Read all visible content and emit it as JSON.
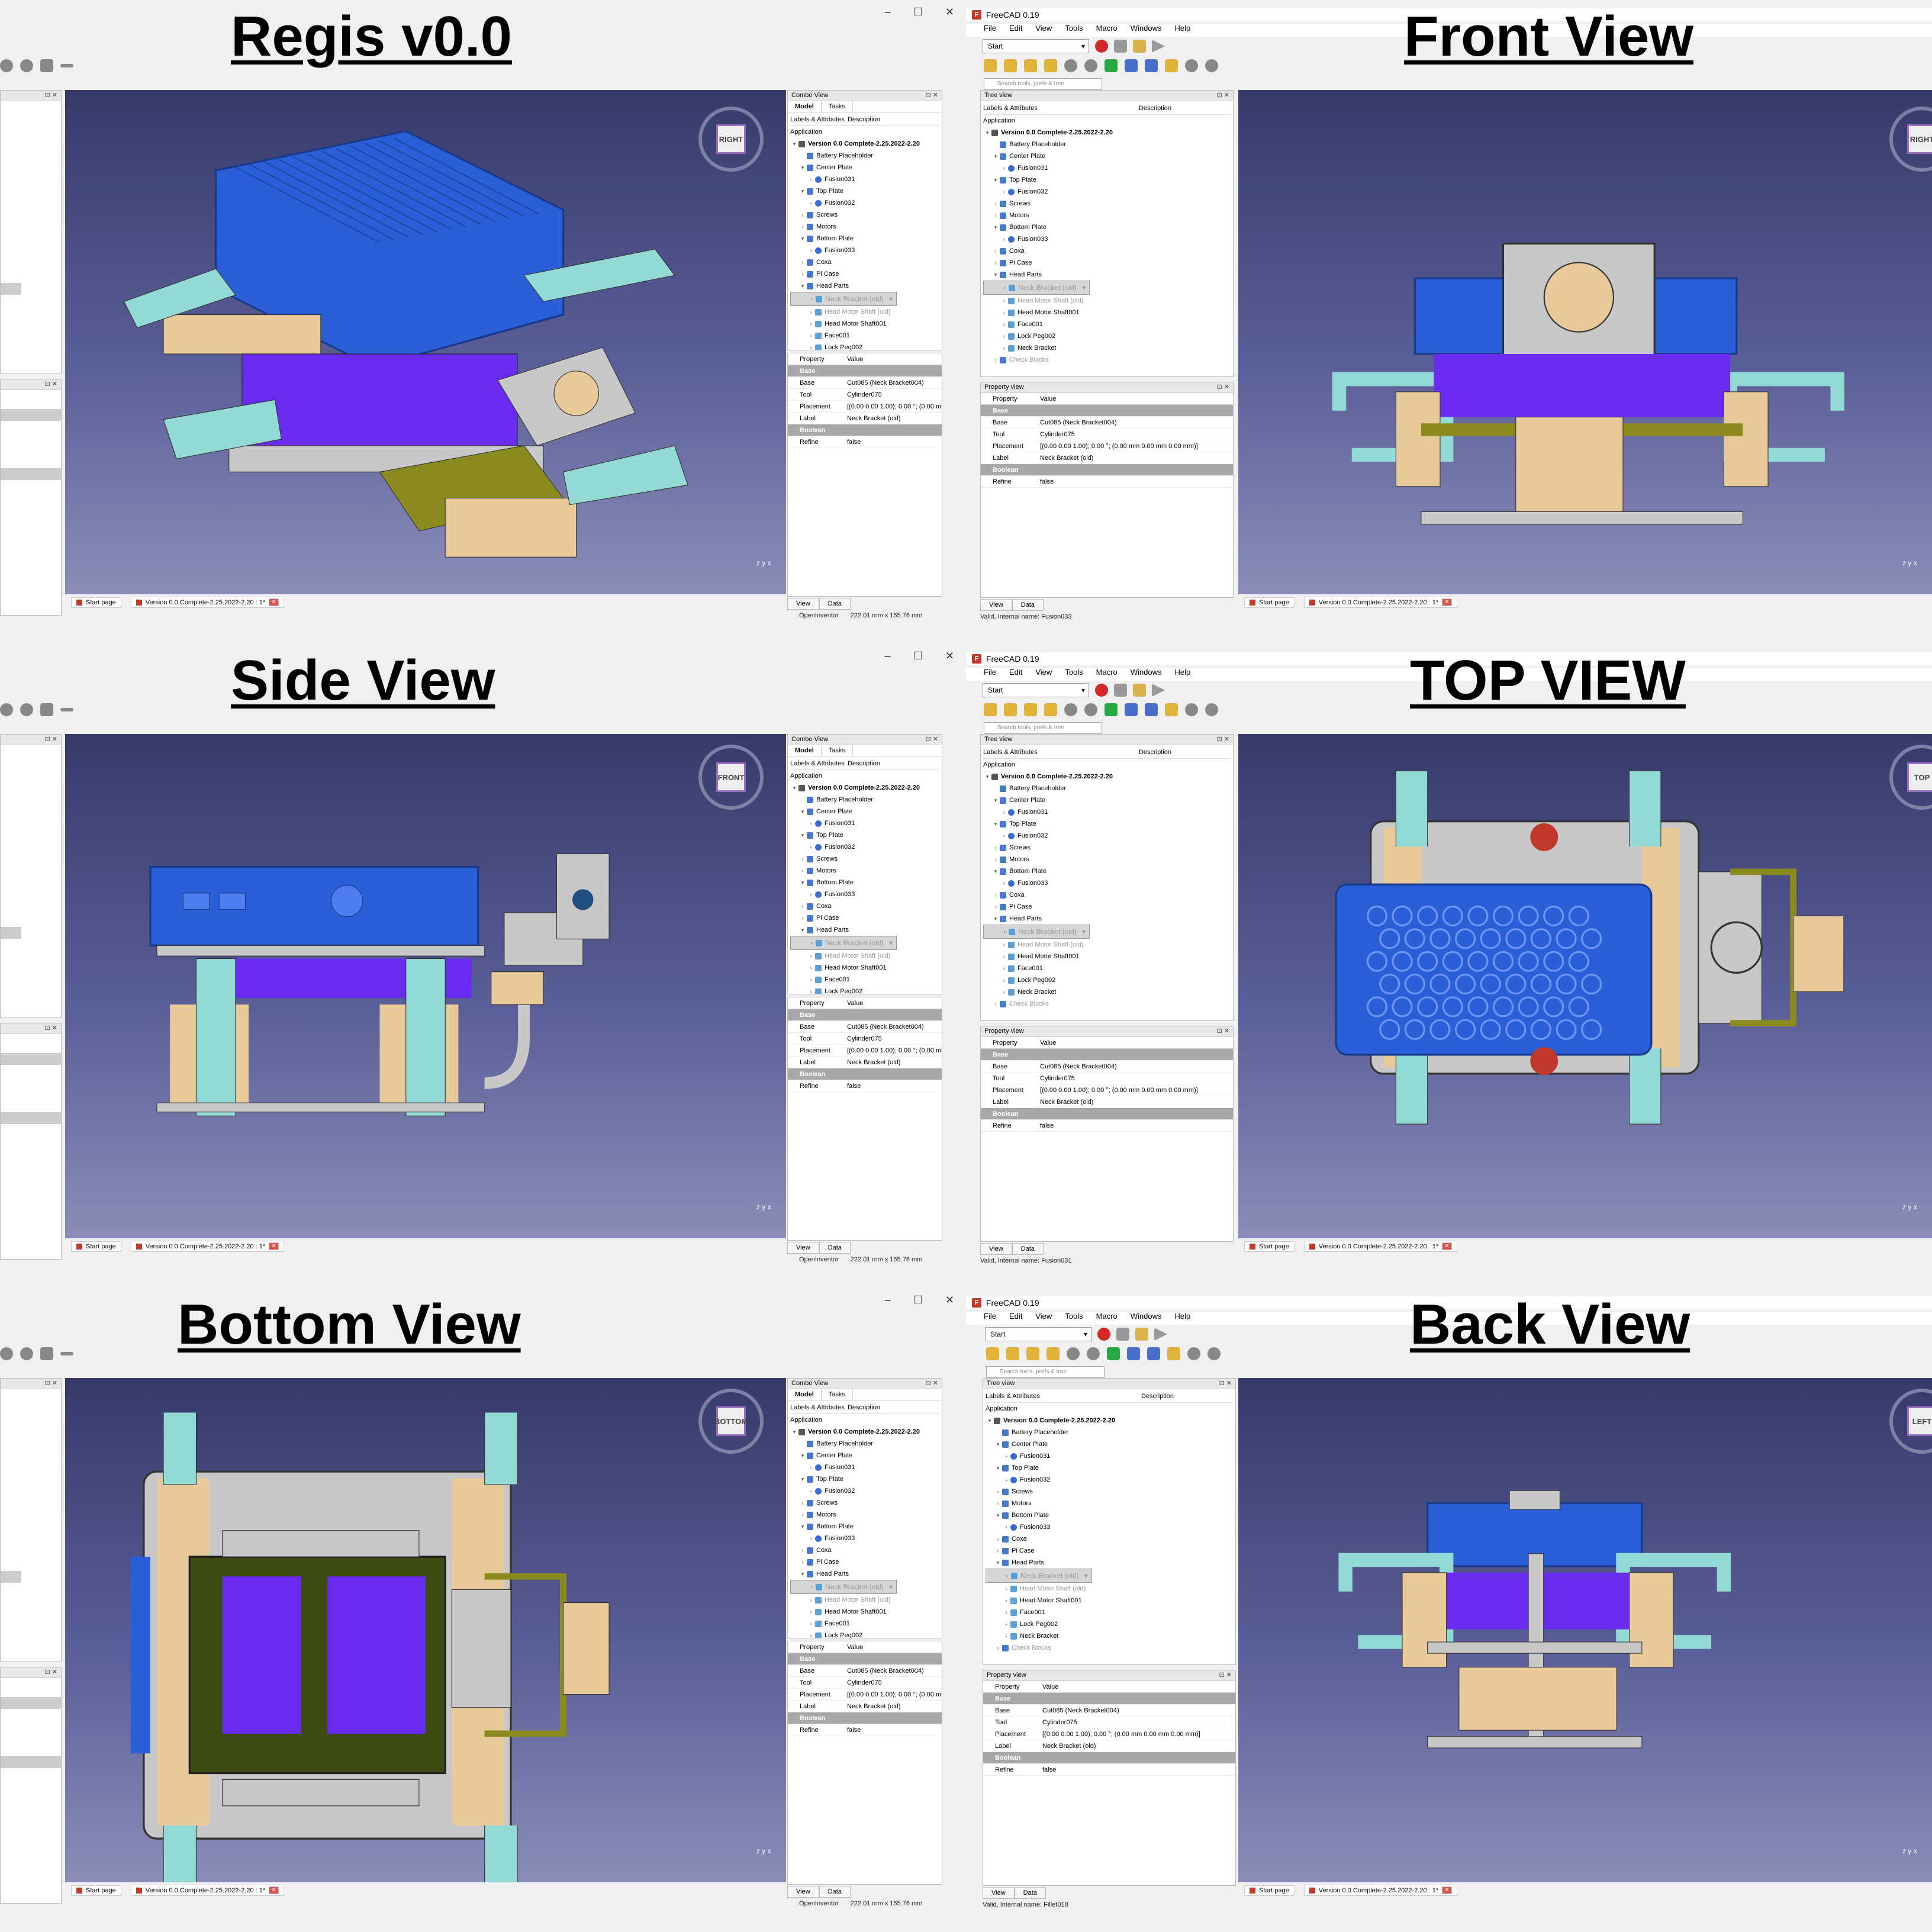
{
  "quadrants": [
    {
      "title": "Regis v0.0",
      "cube": "RIGHT",
      "has_menu": false
    },
    {
      "title": "Front View",
      "cube": "RIGHT",
      "has_menu": true
    },
    {
      "title": "Side View",
      "cube": "FRONT",
      "has_menu": false
    },
    {
      "title": "TOP VIEW",
      "cube": "TOP",
      "has_menu": true
    },
    {
      "title": "Bottom View",
      "cube": "BOTTOM",
      "has_menu": false
    },
    {
      "title": "Back View",
      "cube": "LEFT",
      "has_menu": true
    }
  ],
  "app": {
    "title": "FreeCAD 0.19",
    "menu": [
      "File",
      "Edit",
      "View",
      "Tools",
      "Macro",
      "Windows",
      "Help"
    ],
    "workbench": "Start",
    "search_placeholder": "Search tools, prefs & tree"
  },
  "combo": {
    "title": "Combo View",
    "tabs": [
      "Model",
      "Tasks"
    ],
    "tree_title": "Tree view",
    "col_labels": "Labels & Attributes",
    "col_desc": "Description",
    "application": "Application",
    "tree": [
      {
        "label": "Version 0.0 Complete-2.25.2022-2.20",
        "level": 0,
        "arrow": "▾",
        "bold": true,
        "icon": "app"
      },
      {
        "label": "Battery Placeholder",
        "level": 1,
        "arrow": "",
        "icon": "folder"
      },
      {
        "label": "Center Plate",
        "level": 1,
        "arrow": "▾",
        "icon": "folder"
      },
      {
        "label": "Fusion031",
        "level": 2,
        "arrow": "›",
        "icon": "part"
      },
      {
        "label": "Top Plate",
        "level": 1,
        "arrow": "▾",
        "icon": "folder"
      },
      {
        "label": "Fusion032",
        "level": 2,
        "arrow": "›",
        "icon": "part"
      },
      {
        "label": "Screws",
        "level": 1,
        "arrow": "›",
        "icon": "folder"
      },
      {
        "label": "Motors",
        "level": 1,
        "arrow": "›",
        "icon": "folder"
      },
      {
        "label": "Bottom Plate",
        "level": 1,
        "arrow": "▾",
        "icon": "folder"
      },
      {
        "label": "Fusion033",
        "level": 2,
        "arrow": "›",
        "icon": "part"
      },
      {
        "label": "Coxa",
        "level": 1,
        "arrow": "›",
        "icon": "folder"
      },
      {
        "label": "Pi Case",
        "level": 1,
        "arrow": "›",
        "icon": "folder"
      },
      {
        "label": "Head Parts",
        "level": 1,
        "arrow": "▾",
        "icon": "folder"
      },
      {
        "label": "Neck Bracket (old)",
        "level": 2,
        "arrow": "›",
        "icon": "tool",
        "selected": true,
        "grey": true
      },
      {
        "label": "Head Motor Shaft (old)",
        "level": 2,
        "arrow": "›",
        "icon": "tool",
        "grey": true
      },
      {
        "label": "Head Motor Shaft001",
        "level": 2,
        "arrow": "›",
        "icon": "tool"
      },
      {
        "label": "Face001",
        "level": 2,
        "arrow": "›",
        "icon": "tool"
      },
      {
        "label": "Lock Peg002",
        "level": 2,
        "arrow": "›",
        "icon": "tool"
      },
      {
        "label": "Neck Bracket",
        "level": 2,
        "arrow": "›",
        "icon": "tool"
      },
      {
        "label": "Check Blocks",
        "level": 1,
        "arrow": "›",
        "icon": "folder",
        "grey": true
      }
    ],
    "prop_title": "Property view",
    "prop_header": [
      "Property",
      "Value"
    ],
    "props": [
      {
        "group": "Base"
      },
      {
        "k": "Base",
        "v": "Cut085 (Neck Bracket004)"
      },
      {
        "k": "Tool",
        "v": "Cylinder075"
      },
      {
        "k": "Placement",
        "v": "[(0.00 0.00 1.00); 0.00 °; (0.00 mm  0.00 mm  0.00 mm)]"
      },
      {
        "k": "Label",
        "v": "Neck Bracket (old)"
      },
      {
        "group": "Boolean"
      },
      {
        "k": "Refine",
        "v": "false"
      }
    ],
    "bottom_tabs": [
      "View",
      "Data"
    ]
  },
  "doc_tabs": {
    "start": "Start page",
    "doc": "Version 0.0 Complete-2.25.2022-2.20 : 1*"
  },
  "status": {
    "nav": "OpenInventor",
    "dims": "222.01 mm x 155.76 mm"
  },
  "status_left": [
    "Valid, Internal name: Fusion033",
    "Valid, Internal name: Fusion031",
    "Valid, Internal name: Fillet018"
  ],
  "axis": {
    "x": "x",
    "y": "y",
    "z": "z"
  },
  "colors": {
    "case_blue": "#2a5fd8",
    "bracket_teal": "#93d9d6",
    "motor_tan": "#e8c99a",
    "battery_purple": "#6a2bf0",
    "plate_grey": "#c8c8c8",
    "bottom_olive": "#3d4a12",
    "neck_olive": "#8a8a1e"
  }
}
